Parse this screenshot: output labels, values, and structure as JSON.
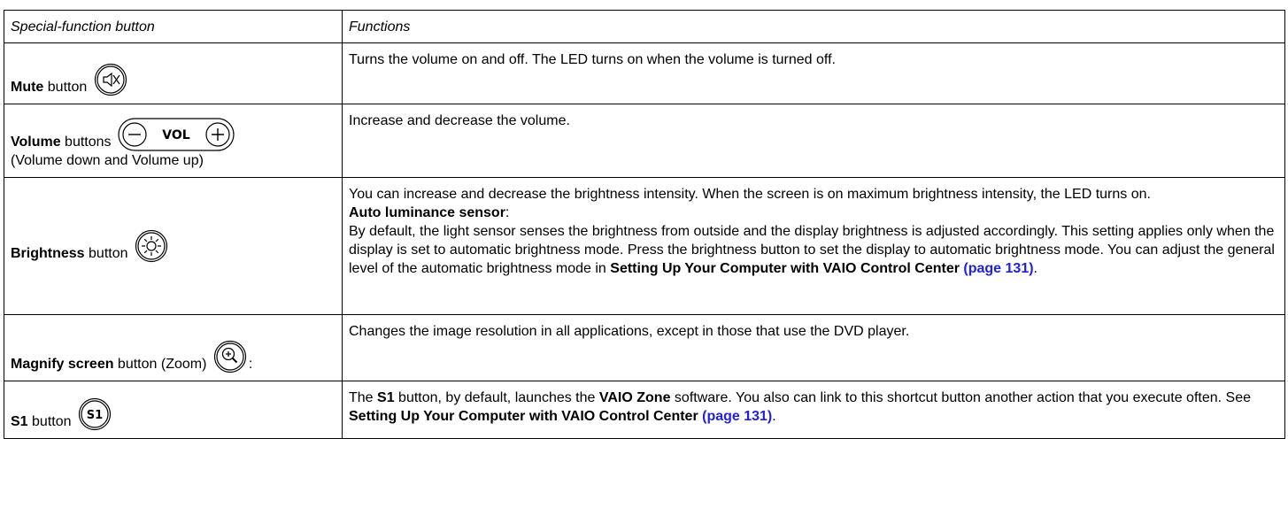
{
  "header": {
    "col1": "Special-function button",
    "col2": "Functions"
  },
  "rows": [
    {
      "name_bold": "Mute",
      "name_rest": " button",
      "icon": "mute-icon",
      "desc": "Turns the volume on and off. The LED turns on when the volume is turned off."
    },
    {
      "name_bold": "Volume",
      "name_rest": " buttons",
      "sub": "(Volume down and Volume up)",
      "icon": "volume-buttons-icon",
      "icon_text": "VOL",
      "desc": "Increase and decrease the volume."
    },
    {
      "name_bold": "Brightness",
      "name_rest": " button",
      "icon": "brightness-icon",
      "desc": "You can increase and decrease the brightness intensity. When the screen is on maximum brightness intensity, the LED turns on.",
      "sub_heading": "Auto luminance sensor",
      "sub_heading_colon": ":",
      "detail": "By default, the light sensor senses the brightness from outside and the display brightness is adjusted accordingly. This setting applies only when the display is set to automatic brightness mode. Press the brightness button to set the display to automatic brightness mode. You can adjust the general level of the automatic brightness mode in ",
      "link_bold": "Setting Up Your Computer with VAIO Control Center",
      "link_page": " (page 131)",
      "end": "."
    },
    {
      "name_bold": "Magnify screen",
      "name_rest": " button (Zoom)",
      "suffix": ":",
      "icon": "zoom-icon",
      "desc": "Changes the image resolution in all applications, except in those that use the DVD player."
    },
    {
      "name_bold": "S1",
      "name_rest": " button",
      "icon": "s1-icon",
      "icon_text": "S1",
      "desc_1": "The ",
      "desc_b1": "S1",
      "desc_2": " button, by default, launches the ",
      "desc_b2": "VAIO Zone",
      "desc_3": " software. You also can link to this shortcut button another action that you execute often. See ",
      "link_bold": "Setting Up Your Computer with VAIO Control Center",
      "link_page": " (page 131)",
      "end": "."
    }
  ]
}
